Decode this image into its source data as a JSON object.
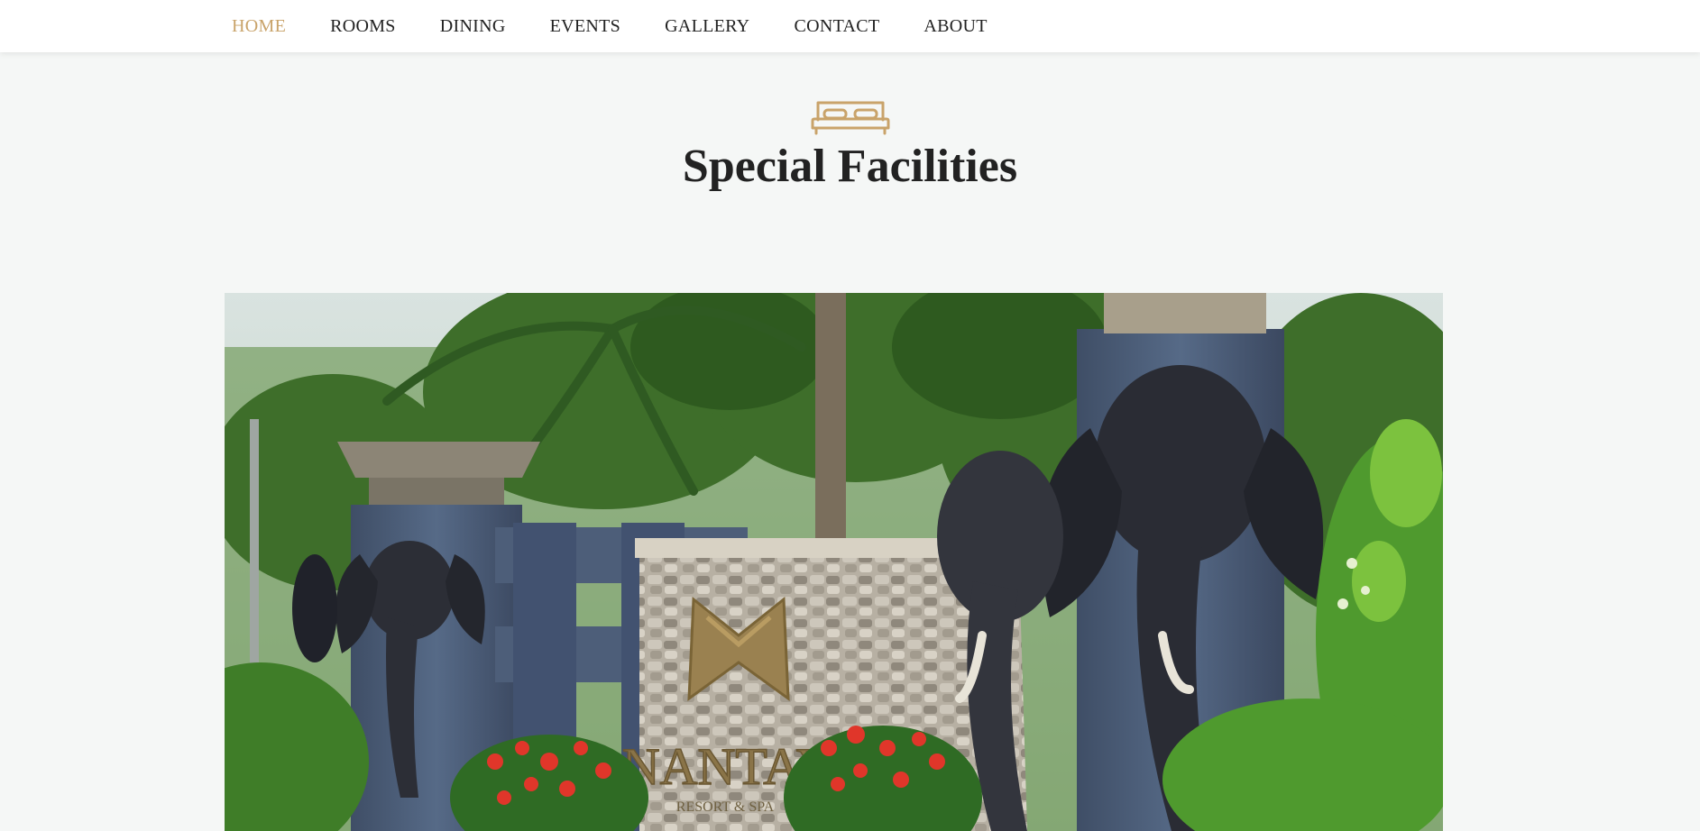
{
  "nav": {
    "items": [
      {
        "label": "HOME",
        "active": true
      },
      {
        "label": "ROOMS",
        "active": false
      },
      {
        "label": "DINING",
        "active": false
      },
      {
        "label": "EVENTS",
        "active": false
      },
      {
        "label": "GALLERY",
        "active": false
      },
      {
        "label": "CONTACT",
        "active": false
      },
      {
        "label": "ABOUT",
        "active": false
      }
    ]
  },
  "section": {
    "icon": "bed-icon",
    "title": "Special Facilities"
  },
  "hero": {
    "sign_text": "ANANTAYA",
    "sign_subtext": "RESORT & SPA",
    "colors": {
      "accent": "#c9a36a",
      "pillar": "#4a5a72",
      "stone": "#b8b2a6",
      "foliage": "#3f7a2e",
      "flowers": "#e23a2a"
    }
  },
  "colors": {
    "accent": "#c9a36a",
    "text": "#222222",
    "background": "#f5f7f6"
  }
}
